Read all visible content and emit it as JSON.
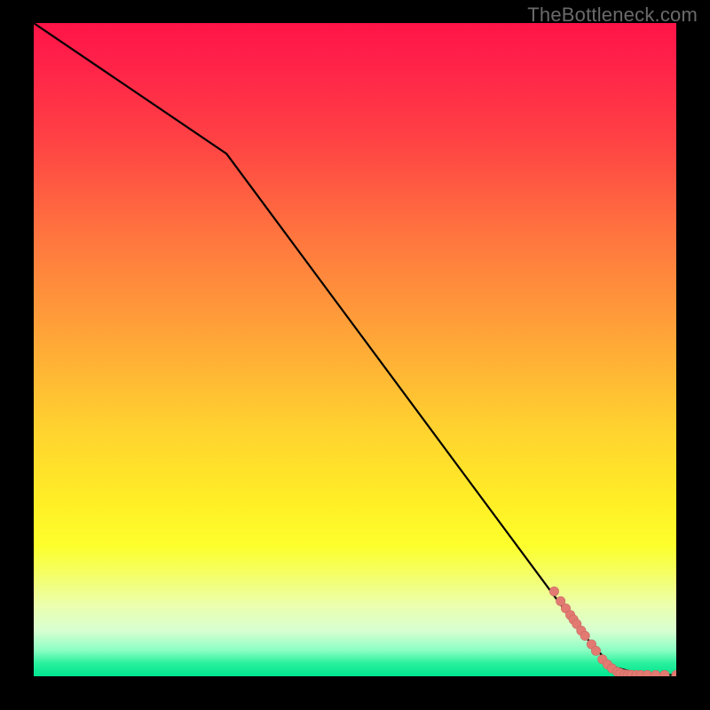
{
  "watermark": "TheBottleneck.com",
  "colors": {
    "line": "#000000",
    "marker_fill": "#e27a72",
    "marker_stroke": "#c96a63",
    "background": "#000000"
  },
  "chart_data": {
    "type": "line",
    "title": "",
    "xlabel": "",
    "ylabel": "",
    "xlim": [
      0,
      100
    ],
    "ylim": [
      0,
      100
    ],
    "grid": false,
    "legend": false,
    "series": [
      {
        "name": "curve",
        "x": [
          0,
          30,
          85,
          90,
          95,
          100
        ],
        "y": [
          100,
          80,
          7,
          1.5,
          0.2,
          0.2
        ]
      }
    ],
    "markers": [
      {
        "x": 81.0,
        "y": 13.0
      },
      {
        "x": 82.0,
        "y": 11.5
      },
      {
        "x": 82.8,
        "y": 10.4
      },
      {
        "x": 83.5,
        "y": 9.4
      },
      {
        "x": 84.0,
        "y": 8.7
      },
      {
        "x": 84.5,
        "y": 8.0
      },
      {
        "x": 85.2,
        "y": 7.0
      },
      {
        "x": 85.8,
        "y": 6.2
      },
      {
        "x": 86.8,
        "y": 4.9
      },
      {
        "x": 87.5,
        "y": 3.9
      },
      {
        "x": 88.5,
        "y": 2.6
      },
      {
        "x": 89.3,
        "y": 1.8
      },
      {
        "x": 90.0,
        "y": 1.2
      },
      {
        "x": 90.8,
        "y": 0.7
      },
      {
        "x": 91.3,
        "y": 0.5
      },
      {
        "x": 92.0,
        "y": 0.3
      },
      {
        "x": 92.5,
        "y": 0.25
      },
      {
        "x": 93.0,
        "y": 0.22
      },
      {
        "x": 93.8,
        "y": 0.2
      },
      {
        "x": 94.5,
        "y": 0.2
      },
      {
        "x": 95.5,
        "y": 0.2
      },
      {
        "x": 96.8,
        "y": 0.2
      },
      {
        "x": 98.2,
        "y": 0.2
      },
      {
        "x": 100.0,
        "y": 0.2
      }
    ]
  }
}
